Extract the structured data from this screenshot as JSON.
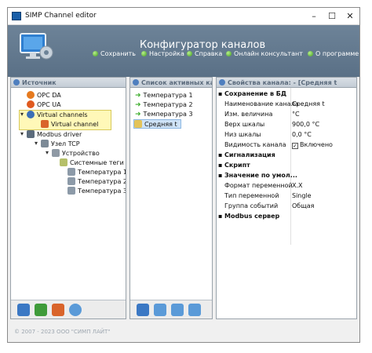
{
  "window": {
    "title": "SIMP Channel editor"
  },
  "header": {
    "title": "Конфигуратор каналов",
    "menu": [
      "Сохранить",
      "Настройка",
      "Справка",
      "Онлайн консультант",
      "О программе"
    ]
  },
  "source_panel": {
    "title": "Источник",
    "items": [
      "OPC DA",
      "OPC UA",
      "Virtual channels",
      "Virtual channel",
      "Modbus driver",
      "Узел TCP",
      "Устройство",
      "Системные теги",
      "Температура 1",
      "Температура 2",
      "Температура 3"
    ]
  },
  "active_panel": {
    "title": "Список активных кана",
    "items": [
      "Температура 1",
      "Температура 2",
      "Температура 3",
      "Средняя t"
    ]
  },
  "props_panel": {
    "title": "Свойства канала: - [Средняя t",
    "sections": {
      "save_db": "Сохранение в БД",
      "signaling": "Сигнализация",
      "script": "Скрипт",
      "default_value": "Значение по умол...",
      "modbus": "Modbus сервер"
    },
    "rows": [
      {
        "name": "Наименование канала",
        "value": "Средняя t"
      },
      {
        "name": "Изм. величина",
        "value": "°C"
      },
      {
        "name": "Верх шкалы",
        "value": "900,0 °C"
      },
      {
        "name": "Низ шкалы",
        "value": "0,0 °C"
      },
      {
        "name": "Видимость канала",
        "value": "Включено"
      }
    ],
    "rows2": [
      {
        "name": "Формат переменной",
        "value": "X.X"
      },
      {
        "name": "Тип переменной",
        "value": "Single"
      },
      {
        "name": "Группа событий",
        "value": "Общая"
      }
    ]
  },
  "footer": {
    "copyright": "© 2007 - 2023  ООО \"СИМП ЛАЙТ\""
  },
  "colors": {
    "header_bg": "#627a90",
    "menu_dot": "#57b52b",
    "selection": "#fff8b8",
    "accent": "#1a5fa8"
  }
}
